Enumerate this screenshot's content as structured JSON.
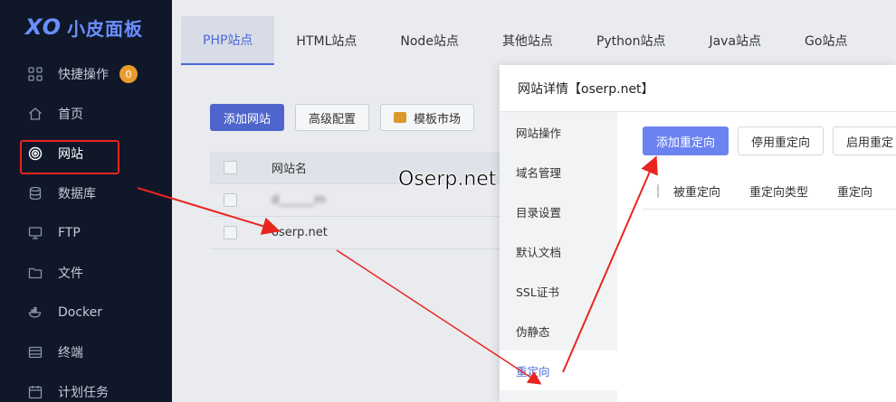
{
  "sidebar": {
    "logo_mark": "XO",
    "logo_text": "小皮面板",
    "items": [
      {
        "label": "快捷操作",
        "icon": "grid-icon",
        "badge": "0"
      },
      {
        "label": "首页",
        "icon": "home-icon"
      },
      {
        "label": "网站",
        "icon": "globe-icon"
      },
      {
        "label": "数据库",
        "icon": "database-icon"
      },
      {
        "label": "FTP",
        "icon": "monitor-icon"
      },
      {
        "label": "文件",
        "icon": "folder-icon"
      },
      {
        "label": "Docker",
        "icon": "docker-icon"
      },
      {
        "label": "终端",
        "icon": "terminal-icon"
      },
      {
        "label": "计划任务",
        "icon": "calendar-icon"
      }
    ]
  },
  "tabs": [
    "PHP站点",
    "HTML站点",
    "Node站点",
    "其他站点",
    "Python站点",
    "Java站点",
    "Go站点"
  ],
  "toolbar": {
    "add_site": "添加网站",
    "advanced": "高级配置",
    "template_market": "模板市场"
  },
  "site_table": {
    "header": "网站名",
    "rows": [
      "d______m",
      "oserp.net"
    ]
  },
  "dialog": {
    "title": "网站详情【oserp.net】",
    "nav": [
      "网站操作",
      "域名管理",
      "目录设置",
      "默认文档",
      "SSL证书",
      "伪静态",
      "重定向"
    ],
    "buttons": {
      "add": "添加重定向",
      "disable": "停用重定向",
      "enable": "启用重定"
    },
    "table_headers": [
      "被重定向",
      "重定向类型",
      "重定向"
    ]
  },
  "watermark": "Oserp.net",
  "colors": {
    "sidebar_bg": "#0f1729",
    "accent": "#4a68d9",
    "annotation_red": "#e8251e"
  }
}
